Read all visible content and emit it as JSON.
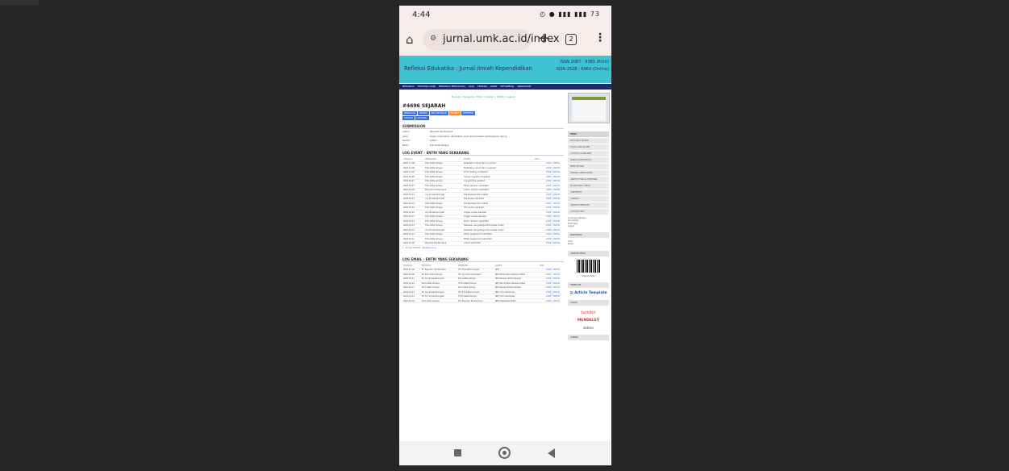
{
  "statusbar": {
    "time": "4:44",
    "status_icons": "◴ ● ▮▮▮ ▮▮▮ 73"
  },
  "browser": {
    "url": "jurnal.umk.ac.id/index",
    "tab_count": "2"
  },
  "site": {
    "title": "Refleksi Edukatika : Jurnal Ilmiah Kependidikan",
    "issn_print": "ISSN 2087 - 9385 (Print)",
    "issn_online": "ISSN 2528 - 696X (Online)",
    "nav": [
      "BERANDA",
      "TENTANG KAMI",
      "BERANDA PENGGUNA",
      "CARI",
      "TERKINI",
      "ARSIP",
      "INFORMASI",
      "ANNOUNCE"
    ]
  },
  "submission": {
    "breadcrumb": "Beranda > Pengguna > Editor > Naskah > #4696 > Sejarah",
    "page_title": "#4696 SEJARAH",
    "tabs": [
      {
        "label": "RINGKASAN",
        "active": false
      },
      {
        "label": "REVIEW",
        "active": false
      },
      {
        "label": "PENYUNTINGAN",
        "active": false
      },
      {
        "label": "SEJARAH",
        "active": true
      },
      {
        "label": "REFERENSI",
        "active": false
      },
      {
        "label": "CATATAN",
        "active": false
      },
      {
        "label": "LOG EMAIL",
        "active": false
      }
    ],
    "section": "SUBMISSION",
    "details": [
      {
        "k": "Author",
        "v": "Bayusari Ika Permana"
      },
      {
        "k": "Judul",
        "v": "Sistem perkuliahan (Pendidikan jarak jauh) berbasis pembelajaran daring"
      },
      {
        "k": "Section",
        "v": "Artikel"
      },
      {
        "k": "Editor",
        "v": "Erik Aditia Ismaya"
      }
    ]
  },
  "event_log": {
    "title": "LOG EVENT - ENTRI YANG SEKARANG",
    "columns": [
      "TANGGAL",
      "PENGGUNA",
      "EVENT",
      "AKSI"
    ],
    "rows": [
      {
        "date": "2020-11-09",
        "user": "Erik Aditia Ismaya",
        "event": "Metadata content item re-upload",
        "action": "LIHAT | HAPUS"
      },
      {
        "date": "2020-11-09",
        "user": "Erik Aditia Ismaya",
        "event": "Metadata content item re-upload",
        "action": "LIHAT | HAPUS"
      },
      {
        "date": "2020-11-02",
        "user": "Erik Aditia Ismaya",
        "event": "Proof reading completed",
        "action": "LIHAT | HAPUS"
      },
      {
        "date": "2020-10-28",
        "user": "Erik Aditia Ismaya",
        "event": "Article copyedit completed",
        "action": "LIHAT | HAPUS"
      },
      {
        "date": "2020-10-27",
        "user": "Erik Aditia Ismaya",
        "event": "Copyedit file updated",
        "action": "LIHAT | HAPUS"
      },
      {
        "date": "2020-10-27",
        "user": "Erik Aditia Ismaya",
        "event": "Editor decision submitted",
        "action": "LIHAT | HAPUS"
      },
      {
        "date": "2020-10-26",
        "user": "Bayusari Ika Permana",
        "event": "Author revision submitted",
        "action": "LIHAT | HAPUS"
      },
      {
        "date": "2020-10-21",
        "user": "Ary Purwantiningsih",
        "event": "File Reviewer file created",
        "action": "LIHAT | HAPUS"
      },
      {
        "date": "2020-10-21",
        "user": "Ary Purwantiningsih",
        "event": "File review uploaded",
        "action": "LIHAT | HAPUS"
      },
      {
        "date": "2020-10-19",
        "user": "Erik Aditia Ismaya",
        "event": "File Reviewer file created",
        "action": "LIHAT | HAPUS"
      },
      {
        "date": "2020-10-19",
        "user": "Erik Aditia Ismaya",
        "event": "File review uploaded",
        "action": "LIHAT | HAPUS"
      },
      {
        "date": "2020-10-15",
        "user": "Ary Purwantiningsih",
        "event": "Trigger review selected",
        "action": "LIHAT | HAPUS"
      },
      {
        "date": "2020-10-15",
        "user": "Erik Aditia Ismaya",
        "event": "Trigger review selected",
        "action": "LIHAT | HAPUS"
      },
      {
        "date": "2020-10-13",
        "user": "Erik Aditia Ismaya",
        "event": "Editor decision submitted",
        "action": "LIHAT | HAPUS"
      },
      {
        "date": "2020-10-13",
        "user": "Erik Aditia Ismaya",
        "event": "Reviewer using Pengunduh review model",
        "action": "LIHAT | HAPUS"
      },
      {
        "date": "2020-10-12",
        "user": "Ary Purwantiningsih",
        "event": "Reviewer using Pengunduh review model",
        "action": "LIHAT | HAPUS"
      },
      {
        "date": "2020-10-12",
        "user": "Erik Aditia Ismaya",
        "event": "Editor assignment submitted",
        "action": "LIHAT | HAPUS"
      },
      {
        "date": "2020-10-12",
        "user": "Erik Aditia Ismaya",
        "event": "Editor assignment submitted",
        "action": "LIHAT | HAPUS"
      },
      {
        "date": "2020-10-09",
        "user": "Bayusari Ika Permana",
        "event": "Article submitted",
        "action": "LIHAT | HAPUS"
      }
    ],
    "pager": "1 - 19 dari 19 Item",
    "clear_link": "Bersihkan Log"
  },
  "email_log": {
    "title": "LOG EMAIL - ENTRI YANG SEKARANG",
    "columns": [
      "TANGGAL",
      "PENGIRIM",
      "PENERIMA",
      "SUBJEK",
      "AKSI"
    ],
    "rows": [
      {
        "date": "2020-11-09",
        "from": "Tit. Bayusari Ika Permana",
        "to": "Tit. Erik Aditia Ismaya",
        "subject": "[RE]",
        "action": "LIHAT | HAPUS"
      },
      {
        "date": "2020-10-28",
        "from": "Tit. Erik Aditia Ismaya",
        "to": "Tit. Ary Purwantiningsih",
        "subject": "[RE] Permintaan Review Artikel",
        "action": "LIHAT | HAPUS"
      },
      {
        "date": "2020-10-21",
        "from": "Tit. Ary Purwantiningsih",
        "to": "Erik Aditia Ismaya",
        "subject": "[RE] Review Artikel Selesai",
        "action": "LIHAT | HAPUS"
      },
      {
        "date": "2020-10-19",
        "from": "Tit.R Aditia Ismaya",
        "to": "Tit.R Aditia Ismaya",
        "subject": "[RE] Permintaan Review Artikel",
        "action": "LIHAT | HAPUS"
      },
      {
        "date": "2020-10-15",
        "from": "Tit.R Aditia Ismaya",
        "to": "Erik Aditia Ismaya",
        "subject": "[RE] Review Artikel Selesai",
        "action": "LIHAT | HAPUS"
      },
      {
        "date": "2020-10-13",
        "from": "Tit. Ary Purwantiningsih",
        "to": "Tit. Erik Aditia Ismaya",
        "subject": "[RE] Ucon Kemitraan",
        "action": "LIHAT | HAPUS"
      },
      {
        "date": "2020-10-12",
        "from": "Tit. Ary Purwantiningsih",
        "to": "Tit.R Aditia Ismaya",
        "subject": "[RE] Ucon Kemitraan",
        "action": "LIHAT | HAPUS"
      },
      {
        "date": "2020-10-09",
        "from": "Tit.R Aditia Ismaya",
        "to": "Tit. Bayusari Ika Permana",
        "subject": "[RE] Dapatman Editor",
        "action": "LIHAT | HAPUS"
      }
    ]
  },
  "sidebar": {
    "menu": [
      "MENU",
      "EDITORIAL BOARD",
      "FOCUS AND SCOPE",
      "AUTHOR GUIDELINES",
      "PUBLICATION ETHICS",
      "PEER REVIEW",
      "ONLINE SUBMISSIONS",
      "ABSTRACTING & INDEXING",
      "PLAGIARISM CHECK",
      "COPYRIGHT",
      "CONTACT",
      "ARTICLE TEMPLATE",
      "AUTHOR FEES"
    ],
    "user_lines": [
      "Anda login sebagai...",
      "erik.ismaya",
      "Profil Saya",
      "Logout"
    ],
    "notif_head": "NOTIFIKASI",
    "notif_lines": [
      "Lihat",
      "Kelola"
    ],
    "visitor_head": "VISITOR STATS",
    "visitor_caption": "View My Stats",
    "template_head": "TEMPLATE",
    "template_label": "Article Template",
    "tools_head": "TOOLS",
    "tool_1": "turnitin",
    "tool_2": "MENDELEY",
    "tool_3": "zotero",
    "license_head": "LISENSI"
  }
}
